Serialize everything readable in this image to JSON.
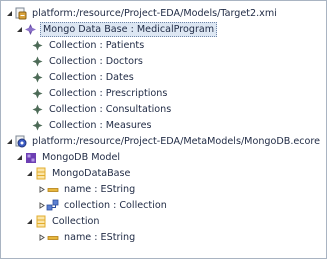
{
  "tree": {
    "resource1": {
      "label": "platform:/resource/Project-EDA/Models/Target2.xmi",
      "root": {
        "label": "Mongo Data Base : MedicalProgram",
        "collections": [
          "Collection : Patients",
          "Collection : Doctors",
          "Collection : Dates",
          "Collection : Prescriptions",
          "Collection : Consultations",
          "Collection : Measures"
        ]
      }
    },
    "resource2": {
      "label": "platform:/resource/Project-EDA/MetaModels/MongoDB.ecore",
      "package": {
        "label": "MongoDB Model",
        "class1": {
          "label": "MongoDataBase",
          "attribute": "name : EString",
          "reference": "collection : Collection"
        },
        "class2": {
          "label": "Collection",
          "attribute": "name : EString"
        }
      }
    }
  },
  "colors": {
    "selection_bg": "#dde7f3",
    "ecore_package": "#6d3fb3",
    "ecore_class": "#e2ac2c",
    "collection_icon": "#4d6b57"
  }
}
